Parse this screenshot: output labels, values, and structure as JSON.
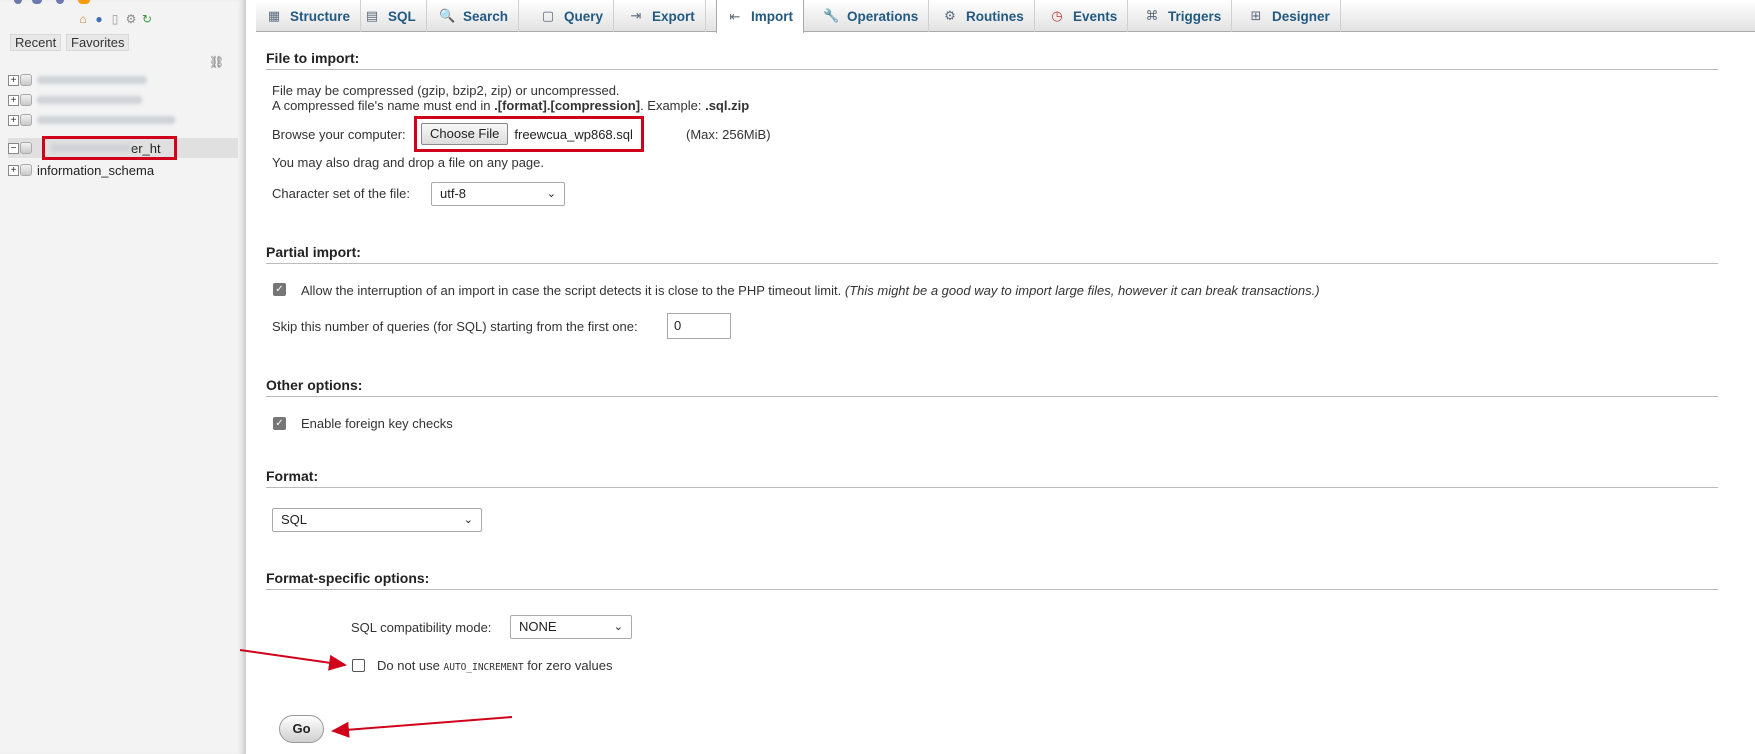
{
  "sidebar": {
    "recent_label": "Recent",
    "favorites_label": "Favorites",
    "databases": [
      {
        "name": "",
        "blurred": true,
        "expander": "+"
      },
      {
        "name": "",
        "blurred": true,
        "expander": "+"
      },
      {
        "name": "",
        "blurred": true,
        "expander": "+"
      },
      {
        "name_suffix": "er_ht",
        "blurred": true,
        "expander": "−",
        "selected": true
      },
      {
        "name": "information_schema",
        "blurred": false,
        "expander": "+"
      }
    ]
  },
  "tabs": [
    {
      "label": "Structure",
      "icon": "structure-icon"
    },
    {
      "label": "SQL",
      "icon": "sql-icon"
    },
    {
      "label": "Search",
      "icon": "search-icon"
    },
    {
      "label": "Query",
      "icon": "query-icon"
    },
    {
      "label": "Export",
      "icon": "export-icon"
    },
    {
      "label": "Import",
      "icon": "import-icon",
      "active": true
    },
    {
      "label": "Operations",
      "icon": "wrench-icon"
    },
    {
      "label": "Routines",
      "icon": "routines-icon"
    },
    {
      "label": "Events",
      "icon": "clock-icon"
    },
    {
      "label": "Triggers",
      "icon": "triggers-icon"
    },
    {
      "label": "Designer",
      "icon": "designer-icon"
    }
  ],
  "file_import": {
    "title": "File to import:",
    "line1": "File may be compressed (gzip, bzip2, zip) or uncompressed.",
    "line2_prefix": "A compressed file's name must end in ",
    "line2_bold": ".[format].[compression]",
    "line2_mid": ". Example: ",
    "line2_example": ".sql.zip",
    "browse_label": "Browse your computer:",
    "choose_file_label": "Choose File",
    "file_name": "freewcua_wp868.sql",
    "max_size": "(Max: 256MiB)",
    "drag_drop": "You may also drag and drop a file on any page.",
    "charset_label": "Character set of the file:",
    "charset_value": "utf-8"
  },
  "partial_import": {
    "title": "Partial import:",
    "allow_interrupt": "Allow the interruption of an import in case the script detects it is close to the PHP timeout limit.",
    "allow_interrupt_note": "(This might be a good way to import large files, however it can break transactions.)",
    "skip_label": "Skip this number of queries (for SQL) starting from the first one:",
    "skip_value": "0"
  },
  "other_options": {
    "title": "Other options:",
    "foreign_key_label": "Enable foreign key checks"
  },
  "format": {
    "title": "Format:",
    "value": "SQL"
  },
  "format_specific": {
    "title": "Format-specific options:",
    "compat_label": "SQL compatibility mode:",
    "compat_value": "NONE",
    "auto_inc_prefix": "Do not use ",
    "auto_inc_code": "AUTO_INCREMENT",
    "auto_inc_suffix": " for zero values"
  },
  "go_label": "Go",
  "colors": {
    "highlight": "#d0021b",
    "tab_text": "#235a81"
  }
}
